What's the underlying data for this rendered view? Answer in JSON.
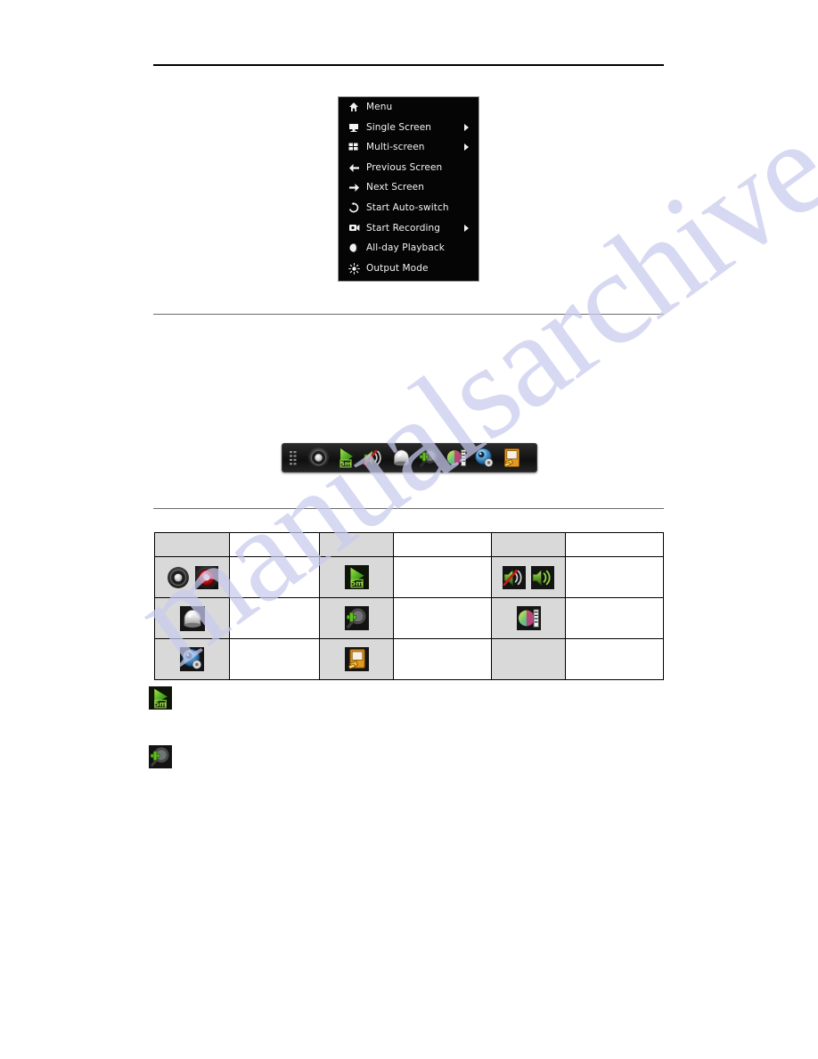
{
  "document": {
    "page_background": "#ffffff",
    "rule_color": "#000000",
    "watermark_text": "manualsarchive.com",
    "watermark_color": "#c9cbee"
  },
  "context_menu": {
    "name": "right-click-menu",
    "background": "#050505",
    "text_color": "#f2f2f2",
    "border_color": "#9a9a9a",
    "items": [
      {
        "label": "Menu",
        "icon": "home-icon",
        "submenu": false
      },
      {
        "label": "Single Screen",
        "icon": "single-screen-icon",
        "submenu": true
      },
      {
        "label": "Multi-screen",
        "icon": "multi-screen-icon",
        "submenu": true
      },
      {
        "label": "Previous Screen",
        "icon": "arrow-left-icon",
        "submenu": false
      },
      {
        "label": "Next Screen",
        "icon": "arrow-right-icon",
        "submenu": false
      },
      {
        "label": "Start Auto-switch",
        "icon": "refresh-icon",
        "submenu": false
      },
      {
        "label": "Start Recording",
        "icon": "camera-record-icon",
        "submenu": true
      },
      {
        "label": "All-day Playback",
        "icon": "playback-moon-icon",
        "submenu": false
      },
      {
        "label": "Output Mode",
        "icon": "brightness-icon",
        "submenu": false
      }
    ]
  },
  "quick_toolbar": {
    "name": "quick-settings-toolbar",
    "background": "#1a1a1a",
    "buttons": [
      {
        "icon": "drag-grip-icon"
      },
      {
        "icon": "record-dark-icon"
      },
      {
        "icon": "playback-5m-icon"
      },
      {
        "icon": "audio-muted-icon"
      },
      {
        "icon": "ptz-dome-icon"
      },
      {
        "icon": "digital-zoom-icon"
      },
      {
        "icon": "image-settings-icon"
      },
      {
        "icon": "preview-config-icon"
      },
      {
        "icon": "exit-monitor-icon"
      }
    ]
  },
  "icon_table": {
    "name": "icon-reference-table",
    "shaded_cell_color": "#d9d9d9",
    "border_color": "#000000",
    "header": [
      {
        "type": "icon",
        "icons": [],
        "shaded": true
      },
      {
        "type": "text",
        "text": "",
        "shaded": false
      },
      {
        "type": "icon",
        "icons": [],
        "shaded": true
      },
      {
        "type": "text",
        "text": "",
        "shaded": false
      },
      {
        "type": "icon",
        "icons": [],
        "shaded": true
      },
      {
        "type": "text",
        "text": "",
        "shaded": false
      }
    ],
    "rows": [
      {
        "cells": [
          {
            "type": "icon",
            "icons": [
              "record-dark-icon",
              "record-red-icon"
            ],
            "shaded": true
          },
          {
            "type": "text",
            "text": "",
            "shaded": false
          },
          {
            "type": "icon",
            "icons": [
              "playback-5m-icon"
            ],
            "shaded": true
          },
          {
            "type": "text",
            "text": "",
            "shaded": false
          },
          {
            "type": "icon",
            "icons": [
              "audio-muted-icon",
              "audio-on-icon"
            ],
            "shaded": true
          },
          {
            "type": "text",
            "text": "",
            "shaded": false
          }
        ]
      },
      {
        "cells": [
          {
            "type": "icon",
            "icons": [
              "ptz-dome-icon"
            ],
            "shaded": true
          },
          {
            "type": "text",
            "text": "",
            "shaded": false
          },
          {
            "type": "icon",
            "icons": [
              "digital-zoom-icon"
            ],
            "shaded": true
          },
          {
            "type": "text",
            "text": "",
            "shaded": false
          },
          {
            "type": "icon",
            "icons": [
              "image-settings-icon"
            ],
            "shaded": true
          },
          {
            "type": "text",
            "text": "",
            "shaded": false
          }
        ]
      },
      {
        "cells": [
          {
            "type": "icon",
            "icons": [
              "preview-config-icon"
            ],
            "shaded": true
          },
          {
            "type": "text",
            "text": "",
            "shaded": false
          },
          {
            "type": "icon",
            "icons": [
              "exit-monitor-icon"
            ],
            "shaded": true
          },
          {
            "type": "text",
            "text": "",
            "shaded": false
          },
          {
            "type": "icon",
            "icons": [],
            "shaded": true
          },
          {
            "type": "text",
            "text": "",
            "shaded": false
          }
        ]
      }
    ]
  },
  "icon_notes": [
    {
      "icon": "playback-5m-icon",
      "text": ""
    },
    {
      "icon": "digital-zoom-icon",
      "text": ""
    }
  ]
}
